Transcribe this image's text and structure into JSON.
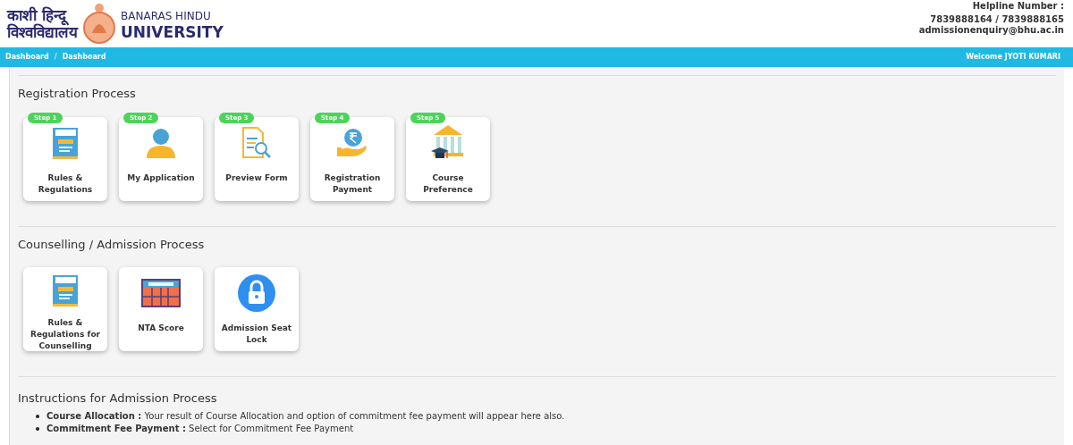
{
  "header": {
    "logo_hindi": [
      "काशी हिन्दू",
      "विश्वविद्यालय"
    ],
    "logo_english": [
      "BANARAS HINDU",
      "UNIVERSITY"
    ],
    "helpline_label": "Helpline Number :",
    "phones": "7839888164 / 7839888165",
    "email": "admissionenquiry@bhu.ac.in"
  },
  "nav": {
    "breadcrumbs": [
      "Dashboard",
      "Dashboard"
    ],
    "separator": "/",
    "welcome": "Welcome JYOTI KUMARI"
  },
  "sections": [
    {
      "title": "Registration Process",
      "cards": [
        {
          "step": "Step 1",
          "label": "Rules & Regulations",
          "kind": "rules"
        },
        {
          "step": "Step 2",
          "label": "My Application",
          "kind": "person"
        },
        {
          "step": "Step 3",
          "label": "Preview Form",
          "kind": "form"
        },
        {
          "step": "Step 4",
          "label": "Registration Payment",
          "kind": "payment"
        },
        {
          "step": "Step 5",
          "label": "Course Preference",
          "kind": "building"
        }
      ]
    },
    {
      "title": "Counselling / Admission Process",
      "cards": [
        {
          "label": "Rules & Regulations for Counselling",
          "kind": "rules"
        },
        {
          "label": "NTA Score",
          "kind": "score"
        },
        {
          "label": "Admission Seat Lock",
          "kind": "lock"
        }
      ]
    }
  ],
  "instructions": {
    "title": "Instructions for Admission Process",
    "items": [
      {
        "term": "Course Allocation :",
        "text": "Your result of Course Allocation and option of commitment fee payment will appear here also."
      },
      {
        "term": "Commitment Fee Payment :",
        "text": "Select for Commitment Fee Payment"
      }
    ]
  }
}
